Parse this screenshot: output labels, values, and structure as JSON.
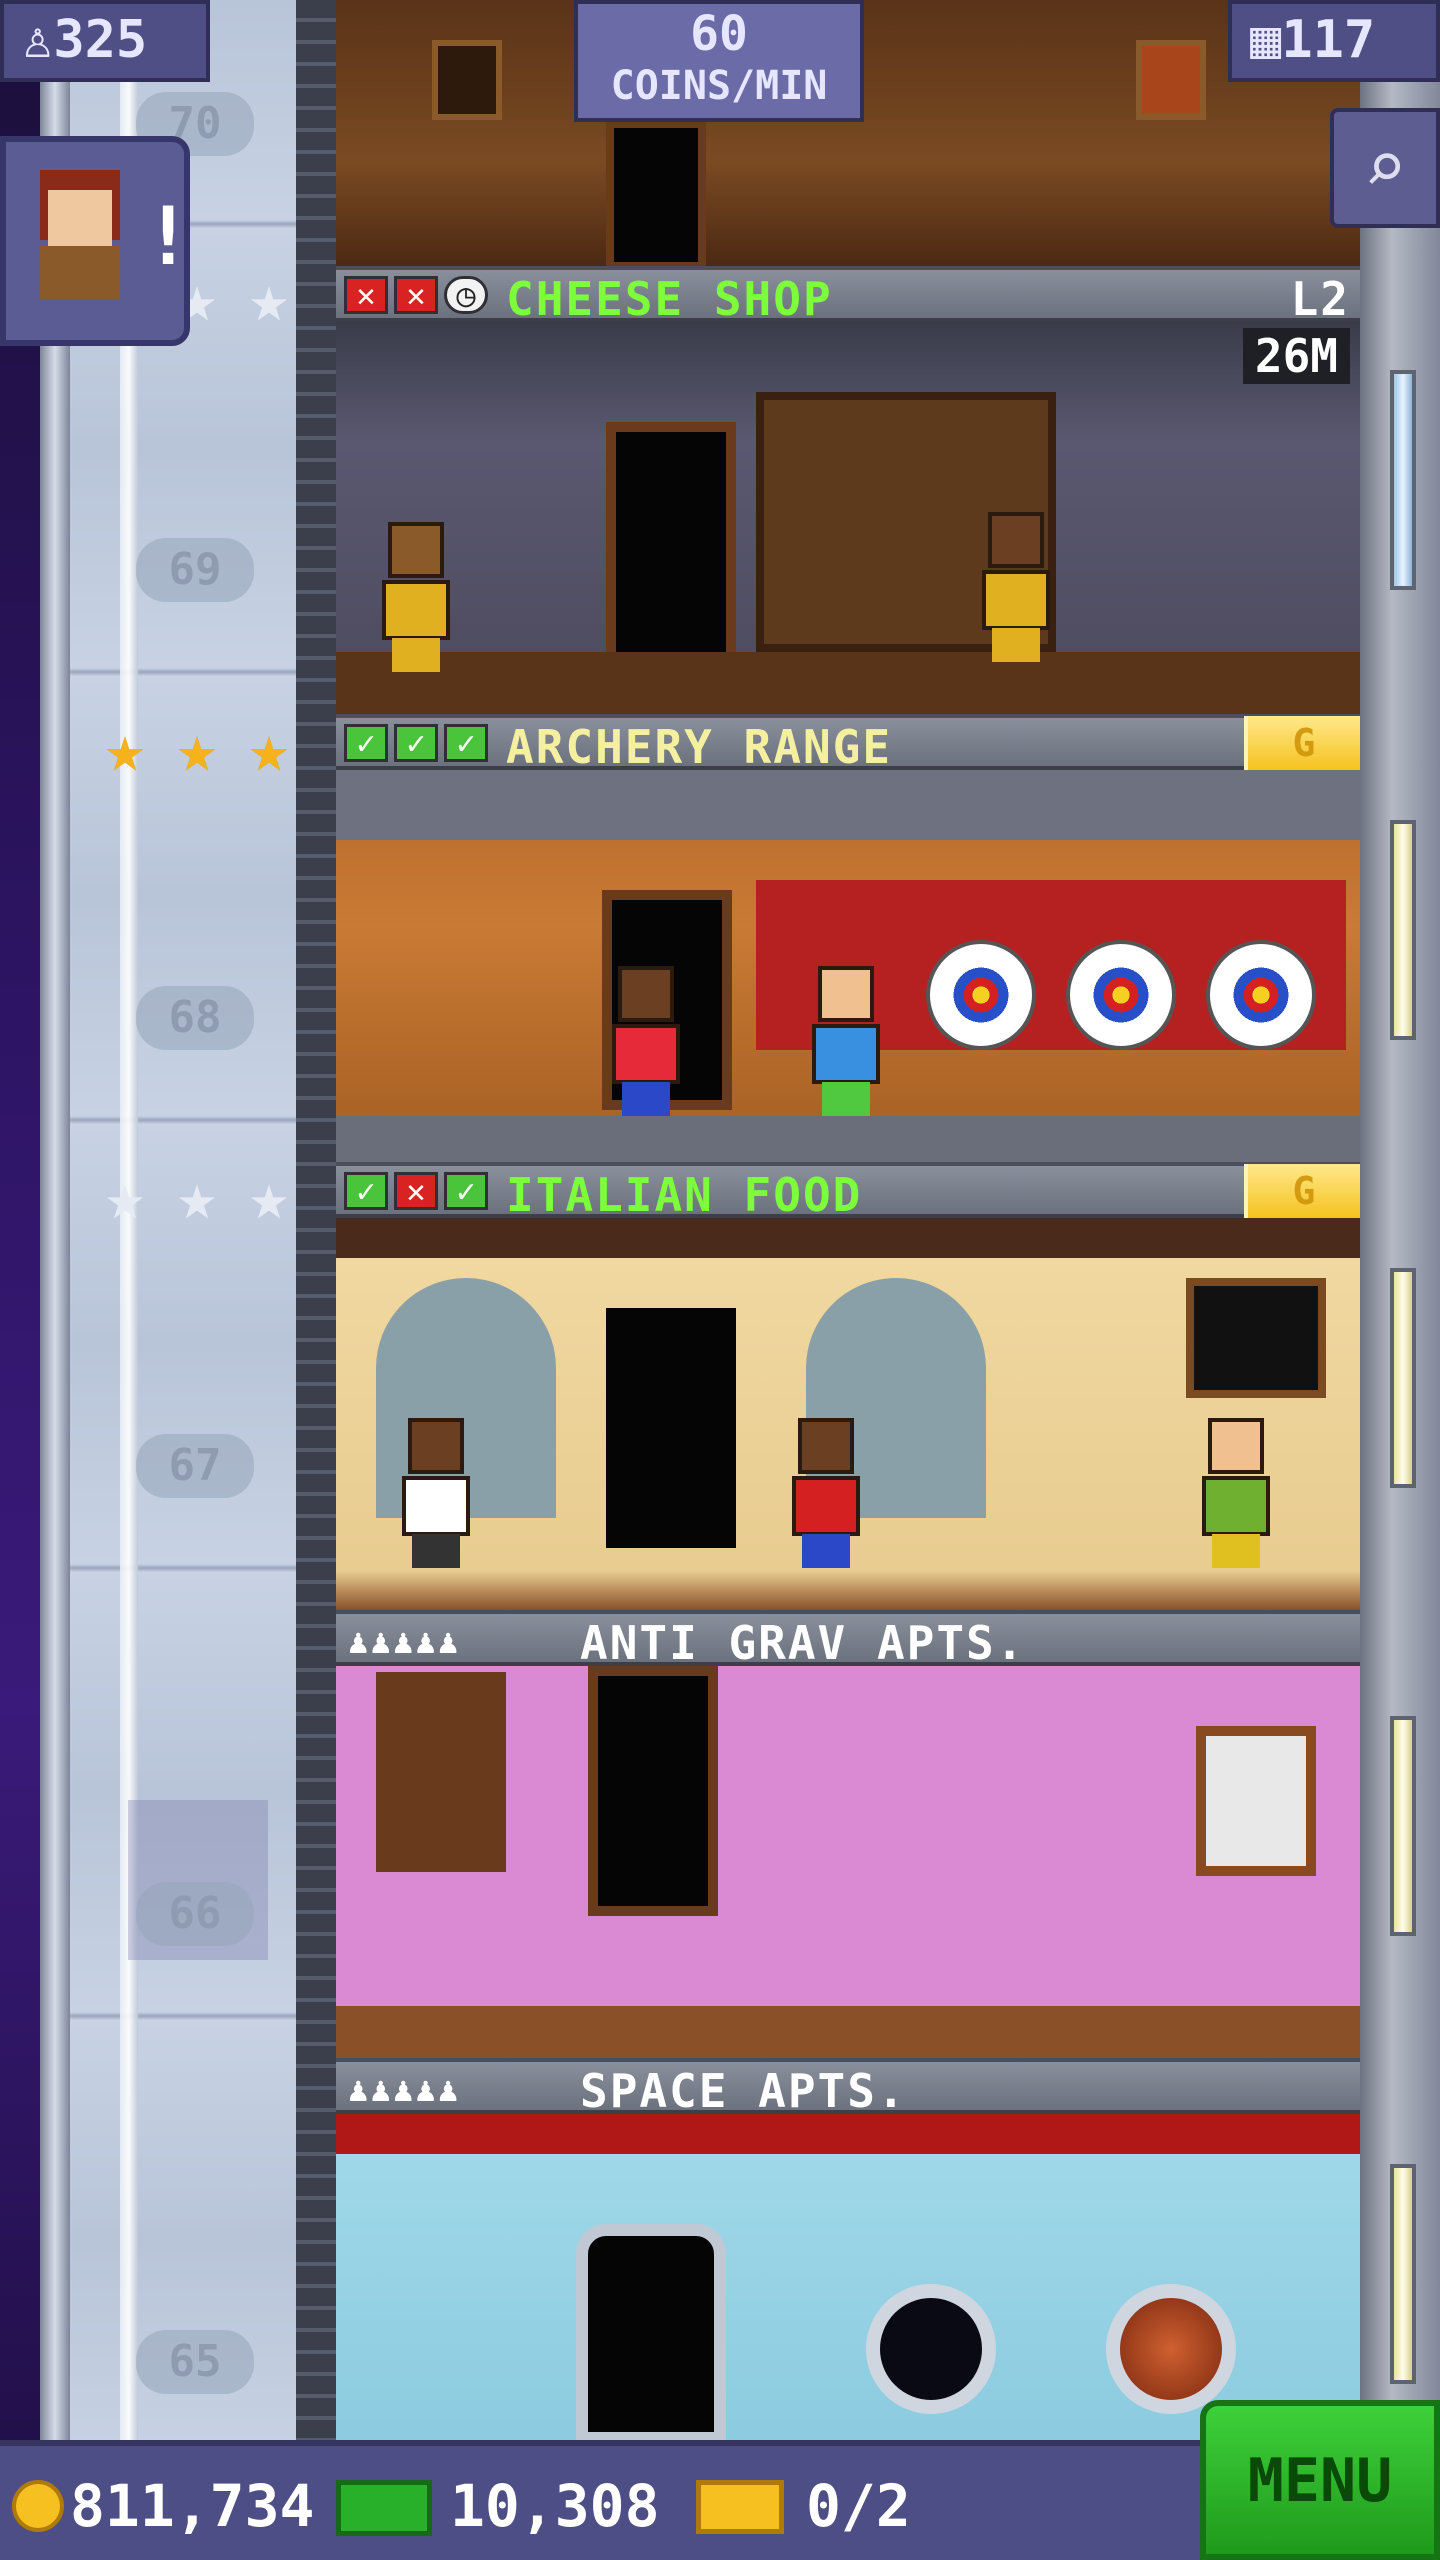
{
  "hud": {
    "population": "325",
    "coins_rate_value": "60",
    "coins_rate_unit": "COINS/MIN",
    "floors_count": "117",
    "search_icon": "magnifier-icon",
    "mission_alert": "!"
  },
  "elevator": {
    "floor_numbers": [
      "70",
      "69",
      "68",
      "67",
      "66",
      "65"
    ]
  },
  "floors": [
    {
      "name": "CHEESE SHOP",
      "status": [
        "x",
        "x",
        "clock"
      ],
      "level": "L2",
      "timer": "26M",
      "stars": [
        "silver",
        "silver",
        "silver"
      ]
    },
    {
      "name": "ARCHERY RANGE",
      "status": [
        "check",
        "check",
        "check"
      ],
      "badge": "G",
      "stars": [
        "gold",
        "gold",
        "gold"
      ]
    },
    {
      "name": "ITALIAN FOOD",
      "status": [
        "check",
        "x",
        "check"
      ],
      "badge": "G",
      "stars": [
        "silver",
        "silver",
        "silver"
      ]
    },
    {
      "name": "ANTI GRAV APTS.",
      "residents_icon": "resident-icons"
    },
    {
      "name": "SPACE APTS.",
      "residents_icon": "resident-icons"
    }
  ],
  "bottom_bar": {
    "coins": "811,734",
    "bux": "10,308",
    "tickets": "0/2",
    "menu_label": "MENU"
  },
  "colors": {
    "name_retail": "#7cff3a",
    "name_residential": "#ffffff",
    "gold_badge": "#f5c320",
    "menu_green": "#2fbf2c"
  }
}
